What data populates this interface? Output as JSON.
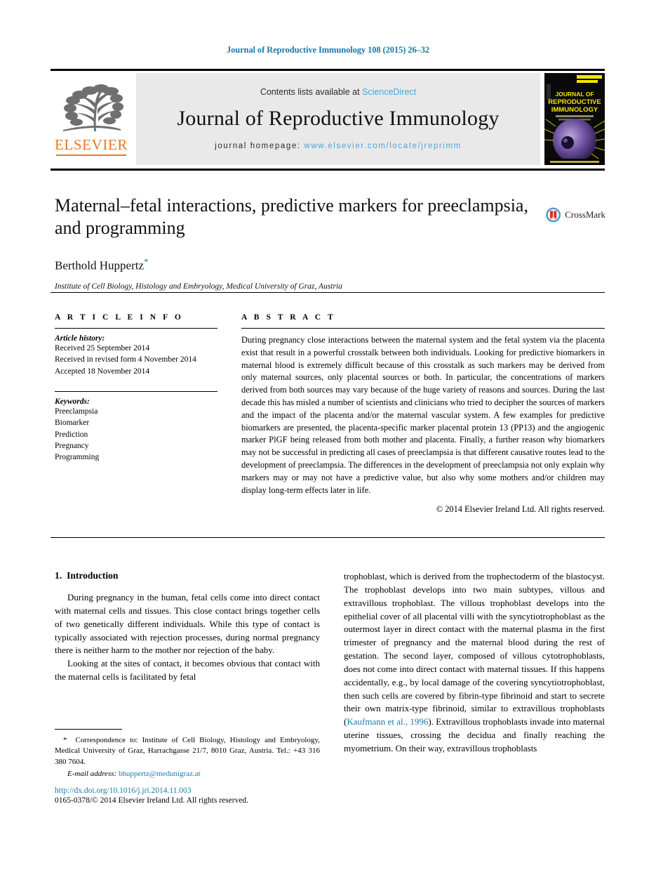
{
  "running_head": "Journal of Reproductive Immunology 108 (2015) 26–32",
  "masthead": {
    "contents_prefix": "Contents lists available at",
    "sciencedirect": "ScienceDirect",
    "journal_title": "Journal of Reproductive Immunology",
    "homepage_label": "journal homepage:",
    "homepage_url": "www.elsevier.com/locate/jreprimm",
    "publisher_wordmark": "ELSEVIER",
    "cover_title_line1": "JOURNAL OF",
    "cover_title_line2": "REPRODUCTIVE",
    "cover_title_line3": "IMMUNOLOGY"
  },
  "article": {
    "title": "Maternal–fetal interactions, predictive markers for preeclampsia, and programming",
    "author": "Berthold Huppertz",
    "author_footnote_marker": "*",
    "affiliation": "Institute of Cell Biology, Histology and Embryology, Medical University of Graz, Austria",
    "crossmark_label": "CrossMark"
  },
  "info": {
    "heading": "A R T I C L E  I N F O",
    "history_label": "Article history:",
    "history": [
      "Received 25 September 2014",
      "Received in revised form 4 November 2014",
      "Accepted 18 November 2014"
    ],
    "keywords_label": "Keywords:",
    "keywords": [
      "Preeclampsia",
      "Biomarker",
      "Prediction",
      "Pregnancy",
      "Programming"
    ]
  },
  "abstract": {
    "heading": "A B S T R A C T",
    "text": "During pregnancy close interactions between the maternal system and the fetal system via the placenta exist that result in a powerful crosstalk between both individuals. Looking for predictive biomarkers in maternal blood is extremely difficult because of this crosstalk as such markers may be derived from only maternal sources, only placental sources or both. In particular, the concentrations of markers derived from both sources may vary because of the huge variety of reasons and sources. During the last decade this has misled a number of scientists and clinicians who tried to decipher the sources of markers and the impact of the placenta and/or the maternal vascular system. A few examples for predictive biomarkers are presented, the placenta-specific marker placental protein 13 (PP13) and the angiogenic marker PlGF being released from both mother and placenta. Finally, a further reason why biomarkers may not be successful in predicting all cases of preeclampsia is that different causative routes lead to the development of preeclampsia. The differences in the development of preeclampsia not only explain why markers may or may not have a predictive value, but also why some mothers and/or children may display long-term effects later in life.",
    "copyright": "© 2014 Elsevier Ireland Ltd. All rights reserved."
  },
  "body": {
    "section_number": "1.",
    "section_title": "Introduction",
    "left_paragraph_1": "During pregnancy in the human, fetal cells come into direct contact with maternal cells and tissues. This close contact brings together cells of two genetically different individuals. While this type of contact is typically associated with rejection processes, during normal pregnancy there is neither harm to the mother nor rejection of the baby.",
    "left_paragraph_2": "Looking at the sites of contact, it becomes obvious that contact with the maternal cells is facilitated by fetal",
    "right_paragraph_1_before": "trophoblast, which is derived from the trophectoderm of the blastocyst. The trophoblast develops into two main subtypes, villous and extravillous trophoblast. The villous trophoblast develops into the epithelial cover of all placental villi with the syncytiotrophoblast as the outermost layer in direct contact with the maternal plasma in the first trimester of pregnancy and the maternal blood during the rest of gestation. The second layer, composed of villous cytotrophoblasts, does not come into direct contact with maternal tissues. If this happens accidentally, e.g., by local damage of the covering syncytiotrophoblast, then such cells are covered by fibrin-type fibrinoid and start to secrete their own matrix-type fibrinoid, similar to extravillous trophoblasts (",
    "right_citation": "Kaufmann et al., 1996",
    "right_paragraph_1_after": "). Extravillous trophoblasts invade into maternal uterine tissues, crossing the decidua and finally reaching the myometrium. On their way, extravillous trophoblasts"
  },
  "footnote": {
    "marker": "*",
    "correspondence": "Correspondence to: Institute of Cell Biology, Histology and Embryology, Medical University of Graz, Harrachgasse 21/7, 8010 Graz, Austria. Tel.: +43 316 380 7604.",
    "email_label": "E-mail address:",
    "email": "bhuppertz@medunigraz.at"
  },
  "footer": {
    "doi": "http://dx.doi.org/10.1016/j.jri.2014.11.003",
    "issn_line": "0165-0378/© 2014 Elsevier Ireland Ltd. All rights reserved."
  },
  "colors": {
    "link_blue": "#1a7aa8",
    "sciencedirect_blue": "#4da3d6",
    "elsevier_orange": "#E87722",
    "band_gray": "#e9e9ea",
    "cover_yellow": "#f5e500"
  }
}
